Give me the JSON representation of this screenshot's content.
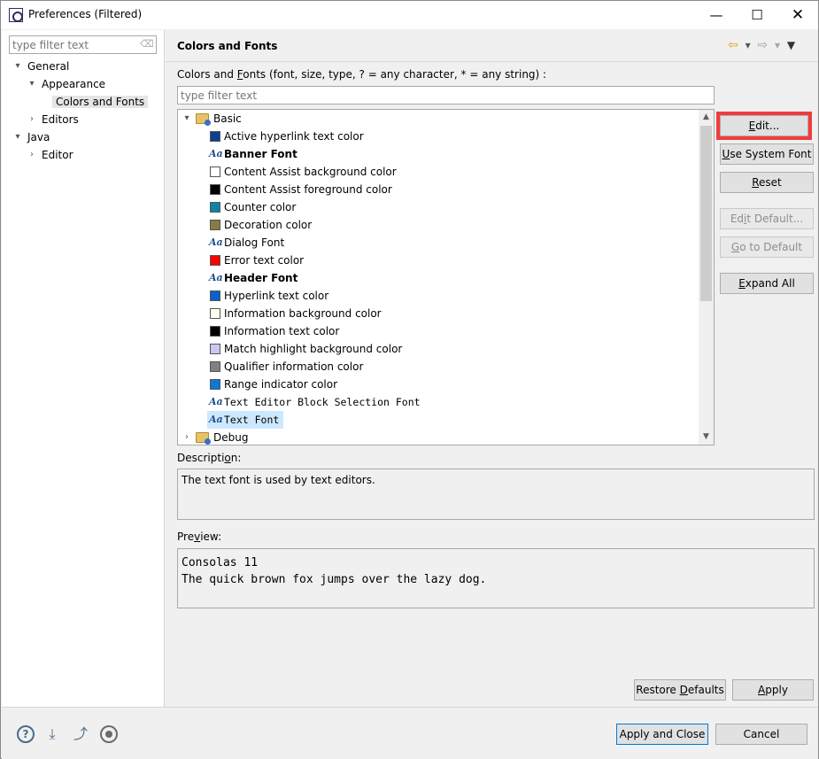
{
  "window": {
    "title": "Preferences (Filtered)",
    "controls": {
      "minimize": "—",
      "maximize": "☐",
      "close": "✕"
    }
  },
  "sidebar": {
    "filter_placeholder": "type filter text",
    "tree": [
      {
        "label": "General",
        "expanded": true,
        "level": 0
      },
      {
        "label": "Appearance",
        "expanded": true,
        "level": 1
      },
      {
        "label": "Colors and Fonts",
        "selected": true,
        "level": 2
      },
      {
        "label": "Editors",
        "expanded": false,
        "level": 1
      },
      {
        "label": "Java",
        "expanded": true,
        "level": 0
      },
      {
        "label": "Editor",
        "expanded": false,
        "level": 1
      }
    ]
  },
  "page": {
    "title": "Colors and Fonts",
    "section_label_pre": "Colors and ",
    "section_label_mnemonic": "F",
    "section_label_post": "onts (font, size, type, ? = any character, * = any string) :",
    "filter_placeholder": "type filter text",
    "tree": {
      "categories": [
        {
          "label": "Basic",
          "expanded": true
        },
        {
          "label": "Debug",
          "expanded": false
        }
      ],
      "items": [
        {
          "label": "Active hyperlink text color",
          "kind": "color",
          "color": "#0d3f8f"
        },
        {
          "label": "Banner Font",
          "kind": "font",
          "bold": true
        },
        {
          "label": "Content Assist background color",
          "kind": "color",
          "color": "#ffffff"
        },
        {
          "label": "Content Assist foreground color",
          "kind": "color",
          "color": "#000000"
        },
        {
          "label": "Counter color",
          "kind": "color",
          "color": "#0b85a5"
        },
        {
          "label": "Decoration color",
          "kind": "color",
          "color": "#8a7a45"
        },
        {
          "label": "Dialog Font",
          "kind": "font"
        },
        {
          "label": "Error text color",
          "kind": "color",
          "color": "#ff0000"
        },
        {
          "label": "Header Font",
          "kind": "font",
          "bold": true
        },
        {
          "label": "Hyperlink text color",
          "kind": "color",
          "color": "#0a62c9"
        },
        {
          "label": "Information background color",
          "kind": "color",
          "color": "#fffff0"
        },
        {
          "label": "Information text color",
          "kind": "color",
          "color": "#000000"
        },
        {
          "label": "Match highlight background color",
          "kind": "color",
          "color": "#c8c8f0"
        },
        {
          "label": "Qualifier information color",
          "kind": "color",
          "color": "#808080"
        },
        {
          "label": "Range indicator color",
          "kind": "color",
          "color": "#0b79d6"
        },
        {
          "label": "Text Editor Block Selection Font",
          "kind": "font",
          "mono": true
        },
        {
          "label": "Text Font",
          "kind": "font",
          "mono": true,
          "selected": true
        }
      ]
    },
    "buttons": {
      "edit": {
        "pre": "",
        "mn": "E",
        "post": "dit..."
      },
      "use_system_font": {
        "pre": "",
        "mn": "U",
        "post": "se System Font"
      },
      "reset": {
        "pre": "",
        "mn": "R",
        "post": "eset"
      },
      "edit_default": {
        "pre": "Ed",
        "mn": "i",
        "post": "t Default..."
      },
      "go_to_default": {
        "pre": "",
        "mn": "G",
        "post": "o to Default"
      },
      "expand_all": {
        "pre": "",
        "mn": "E",
        "post": "xpand All"
      }
    },
    "description_label": {
      "pre": "Descripti",
      "mn": "o",
      "post": "n:"
    },
    "description_text": "The text font is used by text editors.",
    "preview_label": {
      "pre": "Pre",
      "mn": "v",
      "post": "iew:"
    },
    "preview_line1": "Consolas 11",
    "preview_line2": "The quick brown fox jumps over the lazy dog.",
    "restore_defaults": {
      "pre": "Restore ",
      "mn": "D",
      "post": "efaults"
    },
    "apply": {
      "pre": "",
      "mn": "A",
      "post": "pply"
    }
  },
  "footer": {
    "apply_and_close": "Apply and Close",
    "cancel": "Cancel",
    "icons": [
      "help-icon",
      "import-icon",
      "export-icon",
      "record-icon"
    ]
  },
  "colors": {
    "selection": "#cce8ff",
    "highlight_box": "#f03c3c",
    "default_button_border": "#0078d7"
  }
}
